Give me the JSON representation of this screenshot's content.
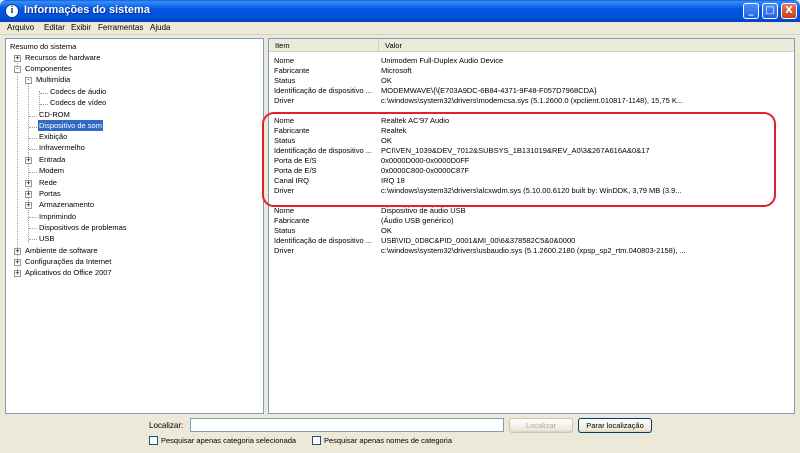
{
  "window": {
    "title": "Informações do sistema",
    "icon": "info-icon",
    "controls": [
      "_",
      "□",
      "X"
    ]
  },
  "menu": [
    "Arquivo",
    "Editar",
    "Exibir",
    "Ferramentas",
    "Ajuda"
  ],
  "tree": {
    "items": [
      {
        "label": "Resumo do sistema"
      },
      {
        "label": "Recursos de hardware",
        "expander": "+"
      },
      {
        "label": "Componentes",
        "expander": "-"
      },
      {
        "label": "Multimídia",
        "expander": "-"
      },
      {
        "label": "Codecs de áudio"
      },
      {
        "label": "Codecs de vídeo"
      },
      {
        "label": "CD-ROM"
      },
      {
        "label": "Dispositivo de som",
        "selected": true
      },
      {
        "label": "Exibição"
      },
      {
        "label": "Infravermelho"
      },
      {
        "label": "Entrada",
        "expander": "+"
      },
      {
        "label": "Modem"
      },
      {
        "label": "Rede",
        "expander": "+"
      },
      {
        "label": "Portas",
        "expander": "+"
      },
      {
        "label": "Armazenamento",
        "expander": "+"
      },
      {
        "label": "Imprimindo"
      },
      {
        "label": "Dispositivos de problemas"
      },
      {
        "label": "USB"
      },
      {
        "label": "Ambiente de software",
        "expander": "+"
      },
      {
        "label": "Configurações da Internet",
        "expander": "+"
      },
      {
        "label": "Aplicativos do Office 2007",
        "expander": "+"
      }
    ]
  },
  "list": {
    "columns": [
      "Item",
      "Valor"
    ],
    "rows": [
      [
        "Nome",
        "Unimodem Full-Duplex Audio Device"
      ],
      [
        "Fabricante",
        "Microsoft"
      ],
      [
        "Status",
        "OK"
      ],
      [
        "Identificação de dispositivo ...",
        "MODEMWAVE\\{\\{E703A9DC-6B84-4371-9F48-F057D7968CDA}"
      ],
      [
        "Driver",
        "c:\\windows\\system32\\drivers\\modemcsa.sys (5.1.2600.0 (xpclient.010817-1148), 15,75 K..."
      ],
      [
        "",
        ""
      ],
      [
        "Nome",
        "Realtek AC'97 Audio"
      ],
      [
        "Fabricante",
        "Realtek"
      ],
      [
        "Status",
        "OK"
      ],
      [
        "Identificação de dispositivo ...",
        "PCI\\VEN_1039&DEV_7012&SUBSYS_1B131019&REV_A0\\3&267A616A&0&17"
      ],
      [
        "Porta de E/S",
        "0x0000D000-0x0000D0FF"
      ],
      [
        "Porta de E/S",
        "0x0000C800-0x0000C87F"
      ],
      [
        "Canal IRQ",
        "IRQ 18"
      ],
      [
        "Driver",
        "c:\\windows\\system32\\drivers\\alcxwdm.sys (5.10.00.6120 built by: WinDDK, 3,79 MB (3.9..."
      ],
      [
        "",
        ""
      ],
      [
        "Nome",
        "Dispositivo de áudio USB"
      ],
      [
        "Fabricante",
        "(Áudio USB genérico)"
      ],
      [
        "Status",
        "OK"
      ],
      [
        "Identificação de dispositivo ...",
        "USB\\VID_0D8C&PID_0001&MI_00\\6&378582C5&0&0000"
      ],
      [
        "Driver",
        "c:\\windows\\system32\\drivers\\usbaudio.sys (5.1.2600.2180 (xpsp_sp2_rtm.040803-2158), ..."
      ]
    ]
  },
  "find": {
    "label": "Localizar:",
    "value": "",
    "find_button": "Localizar",
    "stop_button": "Parar localização",
    "check1": "Pesquisar apenas categoria selecionada",
    "check2": "Pesquisar apenas nomes de categoria"
  }
}
